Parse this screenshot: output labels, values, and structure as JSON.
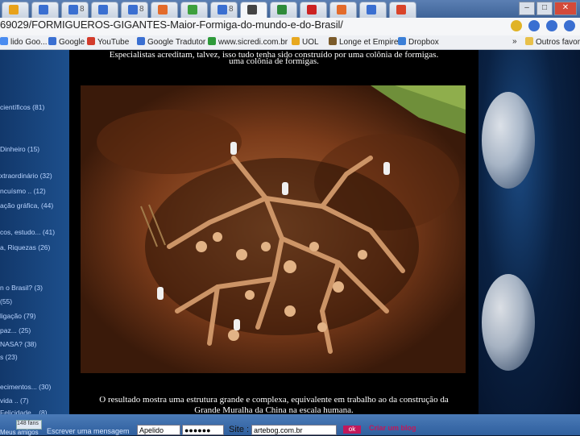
{
  "tabs": [
    {
      "favicon": "#e8a21b"
    },
    {
      "favicon": "#3a6fd1"
    },
    {
      "favicon": "#3a6fd1",
      "text": "8"
    },
    {
      "favicon": "#3a6fd1"
    },
    {
      "favicon": "#3a6fd1",
      "text": "8"
    },
    {
      "favicon": "#e36b2b"
    },
    {
      "favicon": "#3da03d"
    },
    {
      "favicon": "#3a6fd1",
      "text": "8"
    },
    {
      "favicon": "#444444",
      "active": true
    },
    {
      "favicon": "#2e8b3a"
    },
    {
      "favicon": "#cc2222"
    },
    {
      "favicon": "#e36b2b"
    },
    {
      "favicon": "#3a6fd1"
    },
    {
      "favicon": "#d9442a"
    }
  ],
  "address": {
    "url": "69029/FORMIGUEROS-GIGANTES-Maior-Formiga-do-mundo-e-do-Brasil/"
  },
  "bookmarks": [
    {
      "label": "lido Goo...",
      "color": "#4a8cf0"
    },
    {
      "label": "Google",
      "color": "#3a6fd1"
    },
    {
      "label": "YouTube",
      "color": "#d23b2b"
    },
    {
      "label": "Google Tradutor",
      "color": "#3a6fd1"
    },
    {
      "label": "www.sicredi.com.br",
      "color": "#2e9a3a"
    },
    {
      "label": "UOL",
      "color": "#e7a81f"
    },
    {
      "label": "Longe et Empires",
      "color": "#7a5a2a"
    },
    {
      "label": "Dropbox",
      "color": "#3b7fd7"
    }
  ],
  "bookmarks_overflow": "»",
  "other_bookmarks": "Outros favoritos",
  "sidebar_links": [
    "científicos (81)",
    "Dinheiro (15)",
    "xtraordinário (32)",
    "ncuísmo .. (12)",
    "ação gráfica, (44)",
    "cos, estudo... (41)",
    "a, Riquezas (26)",
    "n o Brasil? (3)",
    "(55)",
    "ligação (79)",
    "paz... (25)",
    "NASA? (38)",
    "s (23)",
    "ecimentos... (30)",
    "vida .. (7)",
    "Felicidade .. (8)"
  ],
  "post": {
    "top_caption_line1": "Especialistas acreditam, talvez, isso tudo tenha sido construído por uma colônia de formigas.",
    "top_caption_line2": "uma colônia de formigas.",
    "bottom_caption_line1": "O resultado mostra uma estrutura grande e complexa, equivalente em trabalho ao da construção da",
    "bottom_caption_line2": "Grande Muralha da China na escala humana."
  },
  "footer": {
    "counter": "148 fans",
    "friends": "Meus amigos",
    "send_message": "Escrever uma mensagem",
    "apelido_value": "Apelido",
    "password_value": "●●●●●●",
    "site_label": "Site :",
    "site_value": "artebog.com.br",
    "ok_label": "ok",
    "create_blog": "Criar um blog"
  },
  "colors": {
    "tab_strip": "#4a6fa5",
    "sidebar": "#1a4680",
    "accent_pink": "#c2185b"
  }
}
